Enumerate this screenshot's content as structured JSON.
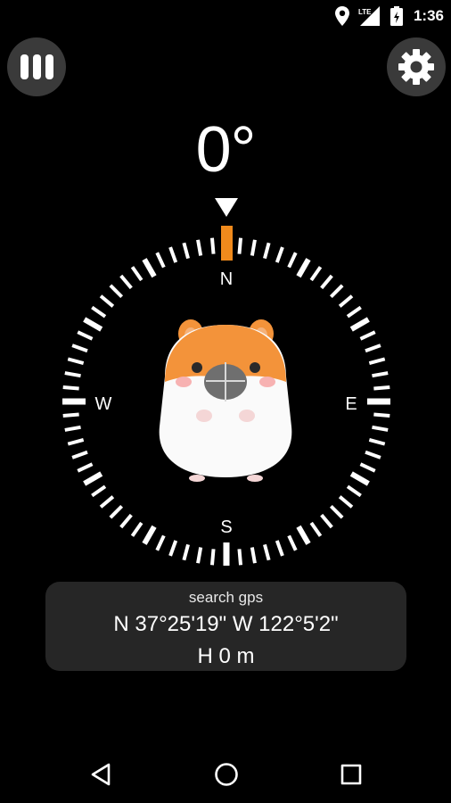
{
  "status_bar": {
    "time": "1:36",
    "network_label": "LTE",
    "icons": [
      "location-pin-icon",
      "signal-icon",
      "battery-icon"
    ]
  },
  "top_bar": {
    "menu_icon": "three-bars-icon",
    "settings_icon": "gear-icon"
  },
  "compass": {
    "heading": "0°",
    "cardinals": {
      "north": "N",
      "east": "E",
      "south": "S",
      "west": "W"
    },
    "accent_color": "#f08a1c",
    "mascot": "hamster-icon"
  },
  "location": {
    "gps_status": "search gps",
    "coordinates": "N 37°25'19\" W 122°5'2\"",
    "altitude": "H  0 m"
  },
  "nav_bar": {
    "back_icon": "back-triangle-icon",
    "home_icon": "home-circle-icon",
    "recents_icon": "recents-square-icon"
  }
}
